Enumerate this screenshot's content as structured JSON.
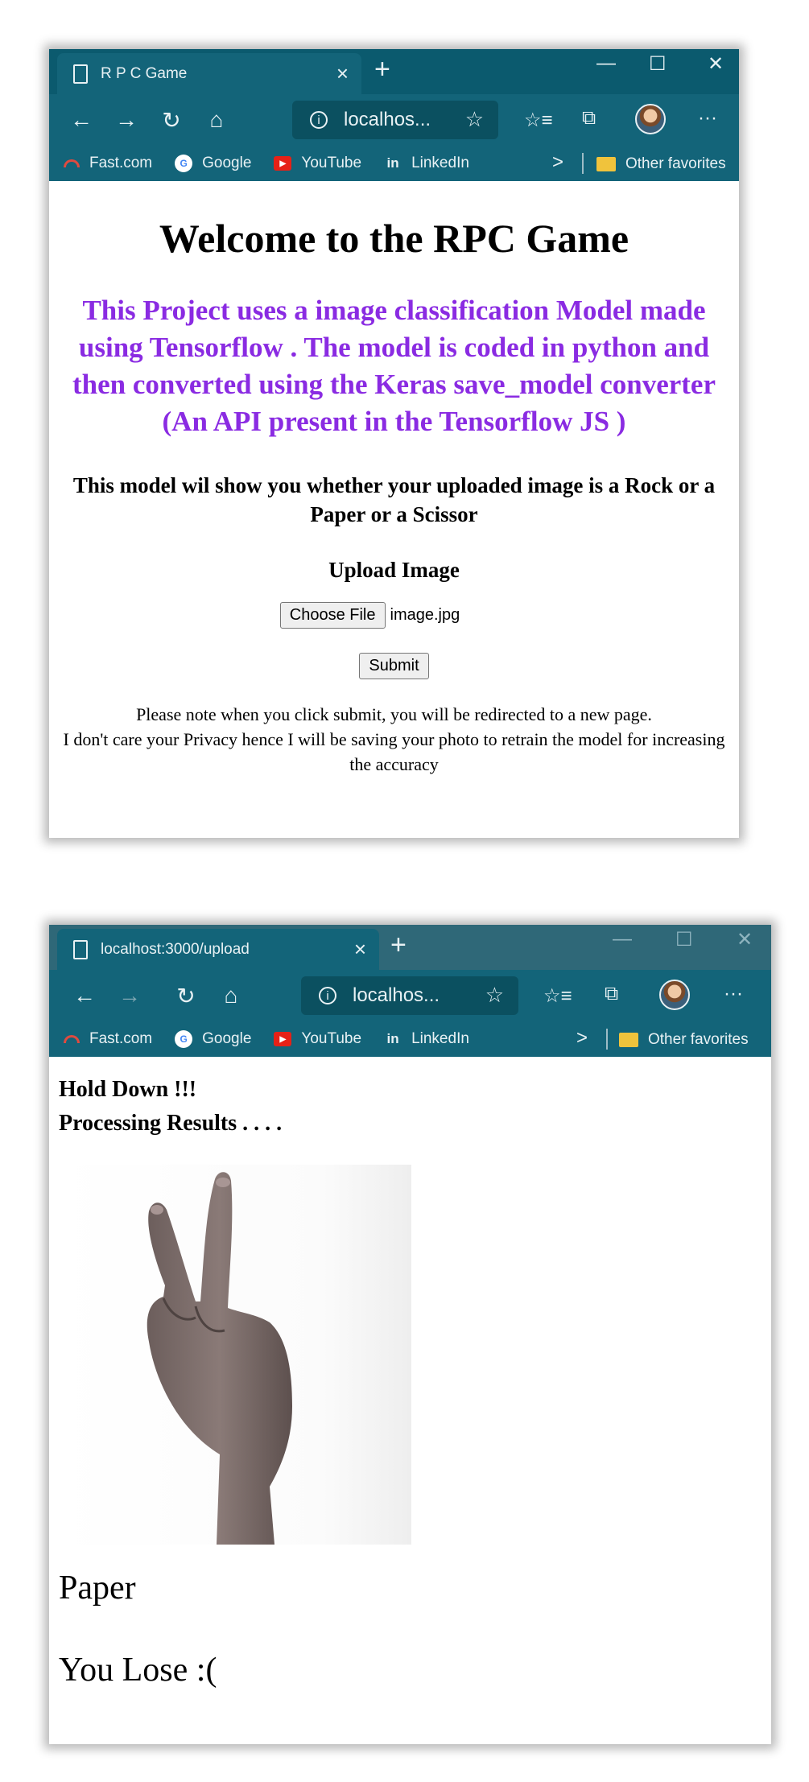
{
  "window1": {
    "tab_title": "R P C Game",
    "tab_close": "×",
    "new_tab": "+",
    "controls": {
      "minimize": "—",
      "maximize": "☐",
      "close": "✕"
    },
    "nav": {
      "back": "←",
      "forward": "→",
      "refresh": "↻",
      "home": "⌂"
    },
    "address": "localhos...",
    "address_star": "☆",
    "toolbar": {
      "favorites": "☆≡",
      "collections": "⧉",
      "more": "···"
    },
    "favorites": [
      {
        "label": "Fast.com",
        "icon": "fast-icon"
      },
      {
        "label": "Google",
        "icon": "google-icon"
      },
      {
        "label": "YouTube",
        "icon": "youtube-icon"
      },
      {
        "label": "LinkedIn",
        "icon": "linkedin-icon"
      }
    ],
    "fav_chevron": ">",
    "other_favorites": "Other favorites",
    "page": {
      "heading": "Welcome to the RPC Game",
      "description": "This Project uses a image classification Model made using Tensorflow . The model is coded in python and then converted using the Keras save_model converter (An API present in the Tensorflow JS )",
      "subheading": "This model wil show you whether your uploaded image is a Rock or a Paper or a Scissor",
      "upload_label": "Upload Image",
      "choose_file": "Choose File",
      "file_name": "image.jpg",
      "submit": "Submit",
      "note_line1": "Please note when you click submit, you will be redirected to a new page.",
      "note_line2": "I don't care your Privacy hence I will be saving your photo to retrain the model for increasing the accuracy"
    }
  },
  "window2": {
    "tab_title": "localhost:3000/upload",
    "tab_close": "×",
    "new_tab": "+",
    "controls": {
      "minimize": "—",
      "maximize": "☐",
      "close": "✕"
    },
    "nav": {
      "back": "←",
      "forward": "→",
      "refresh": "↻",
      "home": "⌂"
    },
    "address": "localhos...",
    "address_star": "☆",
    "toolbar": {
      "favorites": "☆≡",
      "collections": "⧉",
      "more": "···"
    },
    "favorites": [
      {
        "label": "Fast.com",
        "icon": "fast-icon"
      },
      {
        "label": "Google",
        "icon": "google-icon"
      },
      {
        "label": "YouTube",
        "icon": "youtube-icon"
      },
      {
        "label": "LinkedIn",
        "icon": "linkedin-icon"
      }
    ],
    "fav_chevron": ">",
    "other_favorites": "Other favorites",
    "page": {
      "hold": "Hold Down !!!",
      "processing": "Processing Results . . . .",
      "prediction": "Paper",
      "outcome": "You Lose :("
    }
  },
  "colors": {
    "titlebar": "#0b5a6e",
    "toolbar": "#136479",
    "description_text": "#8a2be2"
  }
}
